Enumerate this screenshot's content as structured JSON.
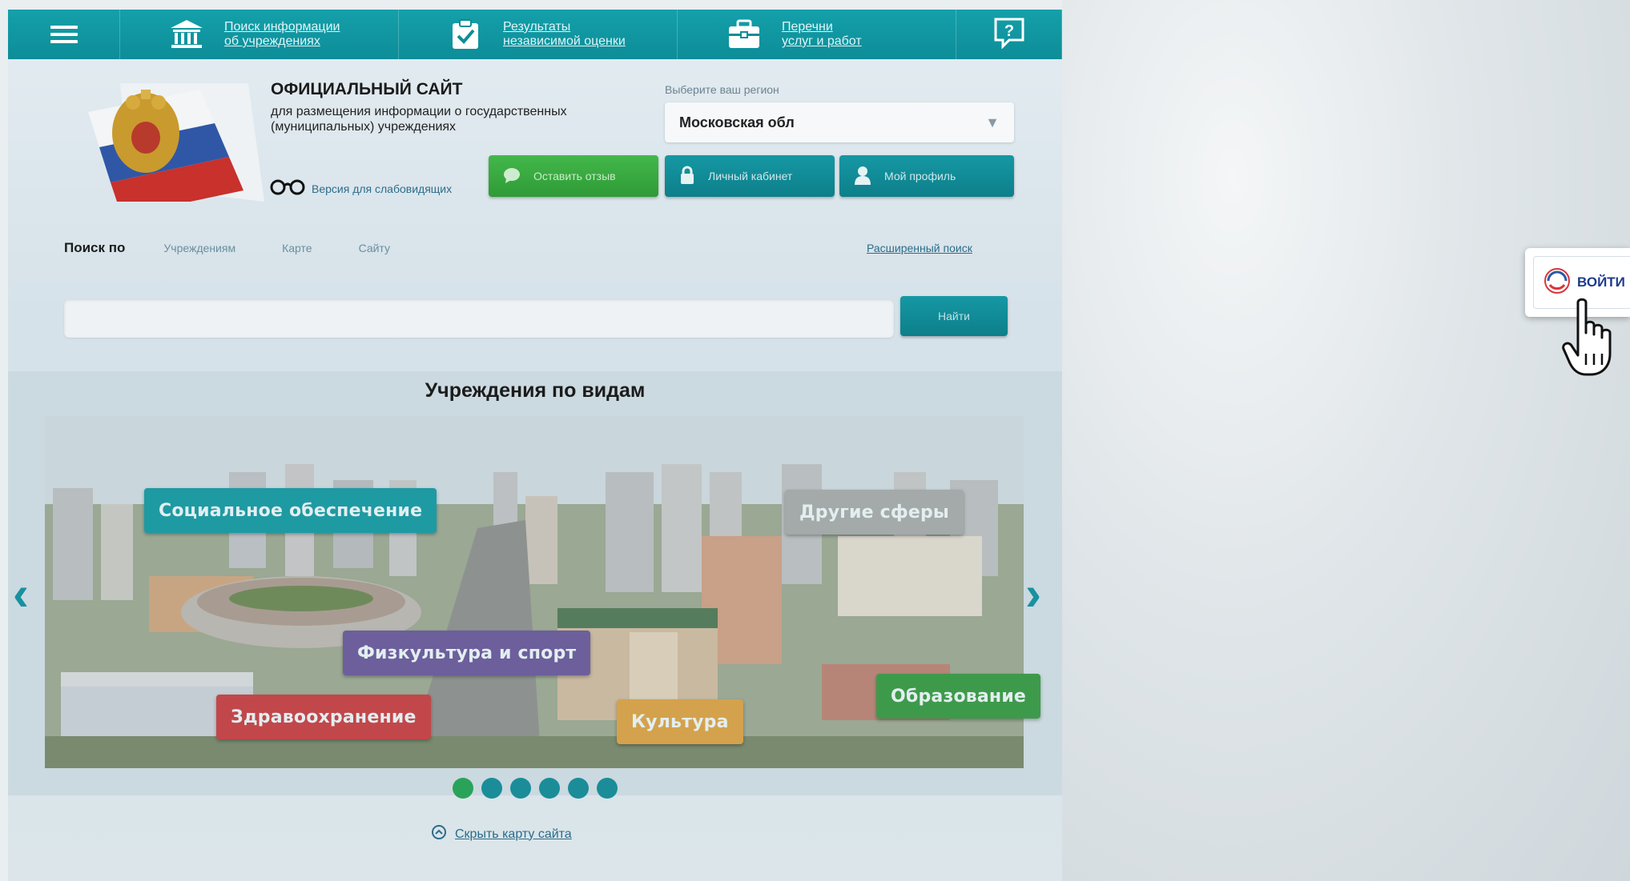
{
  "topbar": {
    "search_link": "Поиск информации\nоб учреждениях",
    "results_link": "Результаты\nнезависимой оценки",
    "services_link": "Перечни\nуслуг и работ"
  },
  "header": {
    "title": "ОФИЦИАЛЬНЫЙ САЙТ",
    "subtitle": "для размещения информации о государственных (муниципальных) учреждениях",
    "low_vision": "Версия для слабовидящих",
    "region_label": "Выберите ваш регион",
    "region_value": "Московская обл",
    "buttons": {
      "feedback": "Оставить отзыв",
      "cabinet": "Личный кабинет",
      "profile": "Мой профиль"
    }
  },
  "search": {
    "by_label": "Поиск по",
    "options": [
      "Учреждениям",
      "Карте",
      "Сайту"
    ],
    "advanced": "Расширенный поиск",
    "button": "Найти",
    "value": ""
  },
  "carousel": {
    "title": "Учреждения по видам",
    "categories": {
      "social": "Социальное обеспечение",
      "other": "Другие сферы",
      "sport": "Физкультура и спорт",
      "health": "Здравоохранение",
      "culture": "Культура",
      "education": "Образование"
    },
    "active_slide": 1,
    "slide_count": 6,
    "hide_map": "Скрыть карту сайта"
  },
  "login": {
    "label": "ВОЙТИ"
  },
  "colors": {
    "teal": "#0d8d98",
    "green": "#2f9a37"
  }
}
